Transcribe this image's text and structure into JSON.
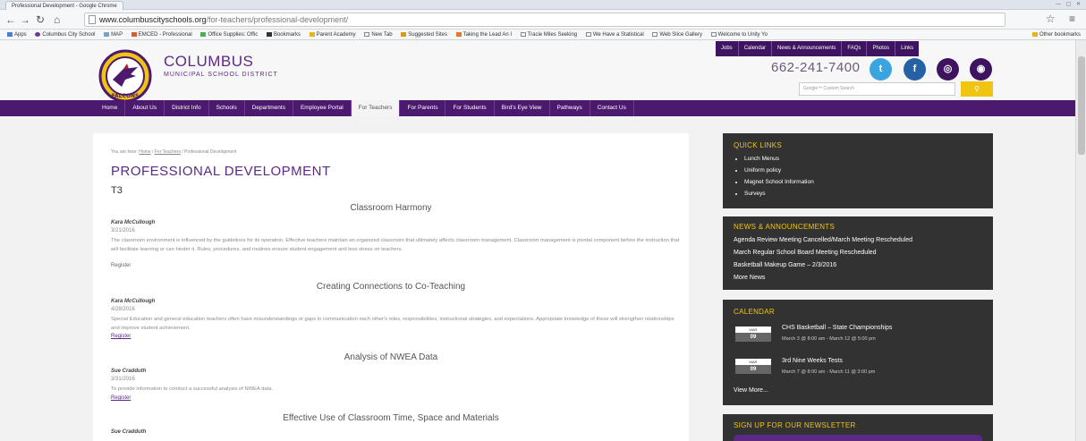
{
  "browser": {
    "tab_title": "Professional Development - Google Chrome",
    "url_host": "www.columbuscityschools.org",
    "url_path": "/for-teachers/professional-development/",
    "bookmarks": [
      "Apps",
      "Columbus City School",
      "MAP",
      "EMCED - Professional",
      "Office Supplies: Offic",
      "Bookmarks",
      "Parent Academy",
      "New Tab",
      "Suggested Sites",
      "Taking the Lead An I",
      "Tracie Miles Seeking",
      "We Have a Statistical",
      "Web Slice Gallery",
      "Welcome to Unity Yo"
    ],
    "other_bookmarks": "Other bookmarks"
  },
  "site": {
    "name_line1": "COLUMBUS",
    "name_line2": "MUNICIPAL SCHOOL DISTRICT",
    "logo_text": "FALCONS",
    "phone": "662-241-7400",
    "search_placeholder": "Google™ Custom Search",
    "util_nav": [
      "Jobs",
      "Calendar",
      "News & Announcements",
      "FAQs",
      "Photos",
      "Links"
    ],
    "main_nav": [
      "Home",
      "About Us",
      "District Info",
      "Schools",
      "Departments",
      "Employee Portal",
      "For Teachers",
      "For Parents",
      "For Students",
      "Bird's Eye View",
      "Pathways",
      "Contact Us"
    ],
    "active_nav": "For Teachers"
  },
  "content": {
    "breadcrumb_prefix": "You are here:",
    "breadcrumb_home": "Home",
    "breadcrumb_sep": " / ",
    "breadcrumb_teachers": "For Teachers",
    "breadcrumb_current": "Professional Development",
    "page_title": "PROFESSIONAL DEVELOPMENT",
    "subtitle": "T3",
    "events": [
      {
        "title": "Classroom Harmony",
        "author": "Kara McCullough",
        "date": "3/21/2016",
        "desc": "The classroom environment is influenced by the guidelines for its operation. Effective teachers maintain an organized classroom that ultimately affects classroom management. Classroom management is pivotal component before the instruction that will facilitate learning or can hinder it. Rules, procedures, and routines ensure student engagement and less stress on teachers.",
        "register": "Register"
      },
      {
        "title": "Creating Connections to Co-Teaching",
        "author": "Kara McCullough",
        "date": "4/28/2016",
        "desc": "Special Education and general education teachers often have misunderstandings or gaps in communication each other's roles, responsibilities, instructional strategies, and expectations. Appropriate knowledge of these will strengthen relationships and improve student achievement.",
        "register": "Register"
      },
      {
        "title": "Analysis of NWEA Data",
        "author": "Sue Cradduth",
        "date": "3/31/2016",
        "desc": "To provide information to conduct a successful analysis of NWEA data.",
        "register": "Register"
      },
      {
        "title": "Effective Use of Classroom Time, Space and Materials",
        "author": "Sue Cradduth",
        "date": "",
        "desc": "",
        "register": ""
      }
    ]
  },
  "sidebar": {
    "quick_links_title": "QUICK LINKS",
    "quick_links": [
      "Lunch Menus",
      "Uniform policy",
      "Magnet School Information",
      "Surveys"
    ],
    "news_title": "NEWS & ANNOUNCEMENTS",
    "news": [
      "Agenda Review Meeting Cancelled/March Meeting Rescheduled",
      "March Regular School Board Meeting Rescheduled",
      "Basketball Makeup Game – 2/3/2016"
    ],
    "news_more": "More News",
    "calendar_title": "CALENDAR",
    "calendar": [
      {
        "month": "MAR",
        "day": "09",
        "title": "CHS Basketball – State Championships",
        "time": "March 3 @ 8:00 am - March 12 @ 5:00 pm"
      },
      {
        "month": "MAR",
        "day": "09",
        "title": "3rd Nine Weeks Tests",
        "time": "March 7 @ 8:00 am - March 11 @ 3:00 pm"
      }
    ],
    "calendar_more": "View More...",
    "newsletter_title": "SIGN UP FOR OUR NEWSLETTER"
  },
  "colors": {
    "brand_purple": "#4b1a6e",
    "accent_yellow": "#f0c413",
    "widget_bg": "#323232",
    "twitter": "#3aa4e0",
    "facebook": "#2461a5",
    "instagram": "#3e1360",
    "rss": "#3e1360"
  },
  "icons": {
    "social": [
      "twitter-icon",
      "facebook-icon",
      "instagram-icon",
      "rss-icon"
    ],
    "search_button": "search-icon"
  }
}
